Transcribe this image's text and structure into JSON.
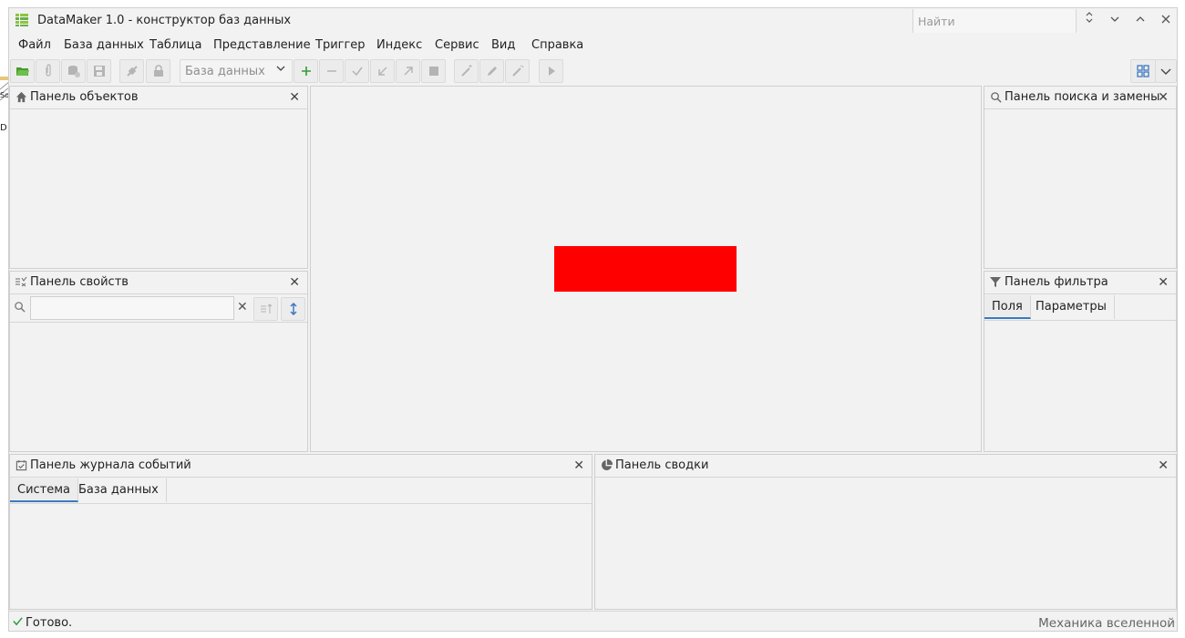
{
  "window": {
    "title": "DataMaker 1.0 - конструктор баз данных",
    "search_placeholder": "Найти"
  },
  "menu": [
    "Файл",
    "База данных",
    "Таблица",
    "Представление",
    "Триггер",
    "Индекс",
    "Сервис",
    "Вид",
    "Справка"
  ],
  "toolbar": {
    "db_select_value": "База данных"
  },
  "panels": {
    "objects": {
      "title": "Панель объектов"
    },
    "properties": {
      "title": "Панель свойств",
      "search_value": ""
    },
    "search_replace": {
      "title": "Панель поиска и замены"
    },
    "filter": {
      "title": "Панель фильтра",
      "tabs": [
        "Поля",
        "Параметры"
      ]
    },
    "event_log": {
      "title": "Панель журнала событий",
      "tabs": [
        "Система",
        "База данных"
      ]
    },
    "summary": {
      "title": "Панель сводки"
    }
  },
  "status": {
    "text": "Готово.",
    "right_text": "Механика вселенной"
  },
  "colors": {
    "accent": "#3c79c0",
    "placeholder_rect": "#ff0000",
    "add_green": "#2e9d3a",
    "app_icon_green": "#8cc63f"
  },
  "desktop_edge_text": [
    "So",
    "D"
  ]
}
